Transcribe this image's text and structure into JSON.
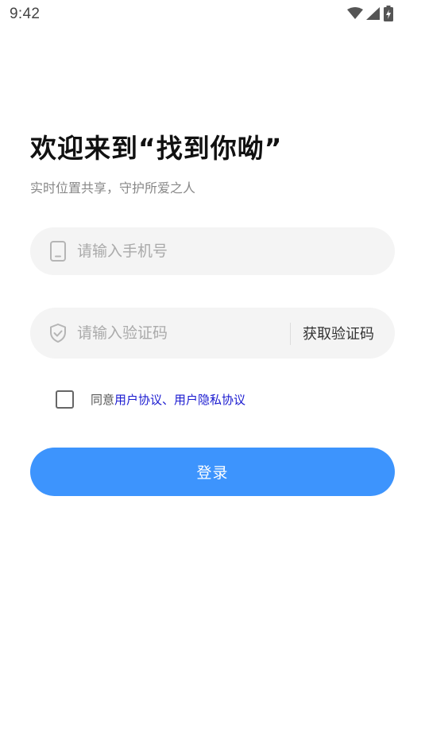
{
  "status_bar": {
    "time": "9:42",
    "icons": [
      "wifi-icon",
      "cell-signal-icon",
      "battery-charging-icon"
    ]
  },
  "header": {
    "title": "欢迎来到“找到你呦”",
    "subtitle": "实时位置共享，守护所爱之人"
  },
  "form": {
    "phone": {
      "icon": "phone-icon",
      "placeholder": "请输入手机号",
      "value": ""
    },
    "code": {
      "icon": "shield-check-icon",
      "placeholder": "请输入验证码",
      "value": "",
      "get_code_label": "获取验证码"
    },
    "agreement": {
      "checked": false,
      "prefix": "同意",
      "user_agreement": "用户协议",
      "separator": "、",
      "privacy_agreement": "用户隐私协议"
    },
    "login_label": "登录"
  },
  "colors": {
    "primary": "#3d94fd",
    "link": "#1a1ad0",
    "field_bg": "#f4f4f4"
  }
}
